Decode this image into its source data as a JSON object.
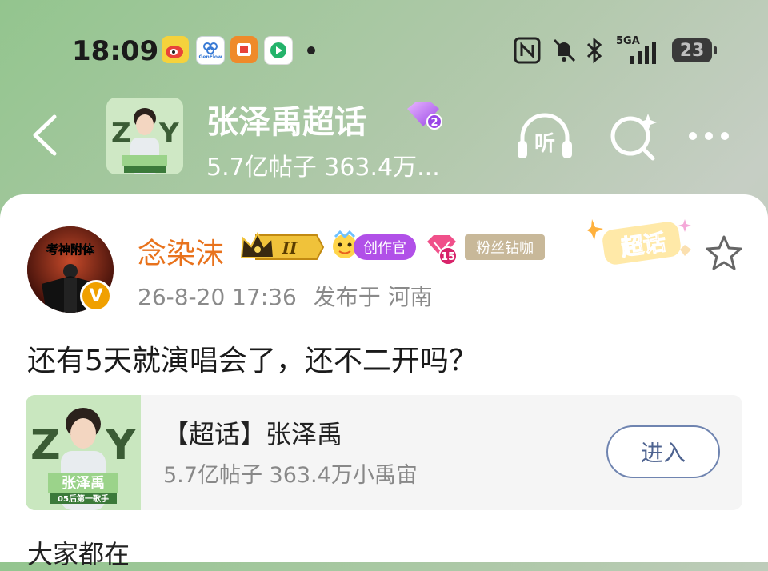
{
  "status_bar": {
    "time": "18:09",
    "apps": [
      {
        "icon": "weibo-icon",
        "color": "#f2d33a"
      },
      {
        "icon": "genflow-icon",
        "label": "GenFlow",
        "color": "#ffffff"
      },
      {
        "icon": "red-app-icon",
        "color": "#ef8a2a"
      },
      {
        "icon": "video-app-icon",
        "color": "#ffffff"
      }
    ],
    "network": "5GA",
    "battery": "23"
  },
  "header": {
    "title": "张泽禹超话",
    "level_badge": "2",
    "subtitle": "5.7亿帖子 363.4万...",
    "listen_label": "听",
    "back_icon": "chevron-left-icon",
    "search_icon": "search-sparkle-icon",
    "more_icon": "more-icon"
  },
  "post": {
    "username": "念染沫",
    "crown_level": "II",
    "creator_badge": "创作官",
    "diamond_level": "15",
    "fan_badge": "粉丝钻咖",
    "chaohua_tag": "超话",
    "avatar_caption": "考神附体",
    "verified_mark": "V",
    "date": "26-8-20 17:36",
    "posted_from": "发布于 河南",
    "content": "还有5天就演唱会了，还不二开吗？"
  },
  "topic_card": {
    "title": "【超话】张泽禹",
    "subtitle": "5.7亿帖子 363.4万小禹宙",
    "enter_button": "进入",
    "poster_name": "张泽禹",
    "poster_caption": "05后第一歌手"
  },
  "cut_text": "大家都在",
  "colors": {
    "username": "#e8721c",
    "enter_button": "#4e6390",
    "creator_badge": "#b150e8",
    "fan_badge": "#c8b899"
  }
}
